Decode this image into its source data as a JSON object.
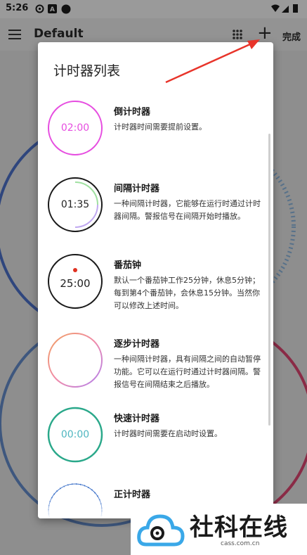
{
  "status_bar": {
    "time": "5:26"
  },
  "app_bar": {
    "title": "Default",
    "done_label": "完成",
    "add_label": "+"
  },
  "dialog": {
    "title": "计时器列表",
    "items": [
      {
        "name": "倒计时器",
        "desc": "计时器时间需要提前设置。",
        "display": "02:00",
        "color": "#e64de0"
      },
      {
        "name": "间隔计时器",
        "desc": "一种间隔计时器，它能够在运行时通过计时器间隔。警报信号在间隔开始时播放。",
        "display": "01:35",
        "color": "#1a1a1a"
      },
      {
        "name": "番茄钟",
        "desc": "默认一个番茄钟工作25分钟，休息5分钟；每到第4个番茄钟，会休息15分钟。当然你可以修改上述时间。",
        "display": "25:00",
        "color": "#1a1a1a"
      },
      {
        "name": "逐步计时器",
        "desc": "一种间隔计时器，具有间隔之间的自动暂停功能。它可以在运行时通过计时器间隔。警报信号在间隔结束之后播放。",
        "display": "",
        "color": "#f08aa8"
      },
      {
        "name": "快速计时器",
        "desc": "计时器时间需要在启动时设置。",
        "display": "00:00",
        "color": "#2aa88a"
      },
      {
        "name": "正计时器",
        "desc": "",
        "display": "",
        "color": "#3a6fc8"
      }
    ]
  },
  "watermark": {
    "brand": "社科在线",
    "url": "cass.com.cn"
  }
}
